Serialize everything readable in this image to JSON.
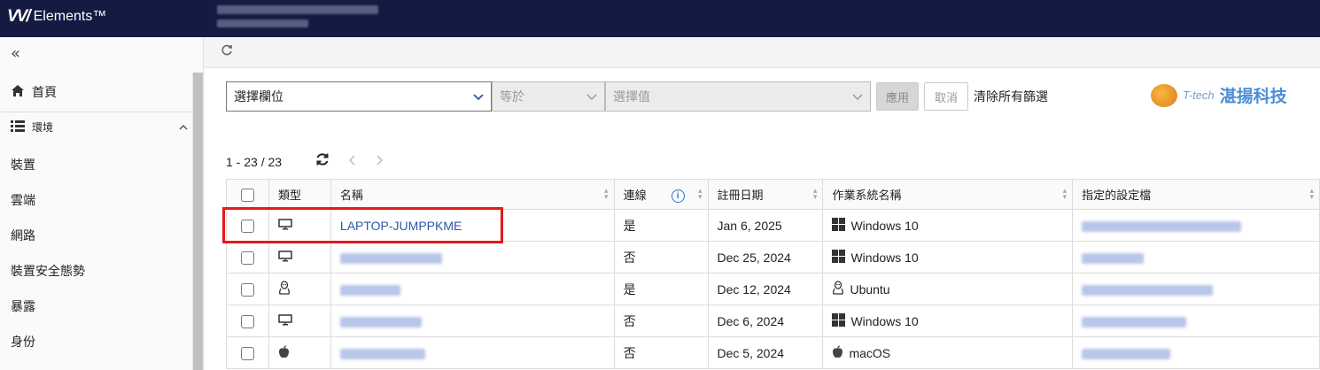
{
  "app": {
    "title": "Elements™"
  },
  "sidebar": {
    "collapse_glyph": "«",
    "items": [
      {
        "label": "首頁",
        "icon": "home-icon"
      },
      {
        "label": "環境",
        "icon": "list-icon"
      },
      {
        "label": "裝置"
      },
      {
        "label": "雲端"
      },
      {
        "label": "網路"
      },
      {
        "label": "裝置安全態勢"
      },
      {
        "label": "暴露"
      },
      {
        "label": "身份"
      }
    ]
  },
  "filter": {
    "field_placeholder": "選擇欄位",
    "operator": "等於",
    "value_placeholder": "選擇值",
    "apply_label": "應用",
    "cancel_label": "取消",
    "clear_label": "清除所有篩選"
  },
  "brand": {
    "tech": "T-tech",
    "name": "湛揚科技"
  },
  "pager": {
    "range": "1 - 23 / 23"
  },
  "table": {
    "columns": [
      "類型",
      "名稱",
      "連線",
      "註冊日期",
      "作業系統名稱",
      "指定的設定檔"
    ],
    "rows": [
      {
        "type": "monitor",
        "name": "LAPTOP-JUMPPKME",
        "connected": "是",
        "date": "Jan 6, 2025",
        "os": "Windows 10",
        "os_icon": "windows"
      },
      {
        "type": "monitor",
        "name": "",
        "connected": "否",
        "date": "Dec 25, 2024",
        "os": "Windows 10",
        "os_icon": "windows"
      },
      {
        "type": "linux",
        "name": "",
        "connected": "是",
        "date": "Dec 12, 2024",
        "os": "Ubuntu",
        "os_icon": "linux"
      },
      {
        "type": "monitor",
        "name": "",
        "connected": "否",
        "date": "Dec 6, 2024",
        "os": "Windows 10",
        "os_icon": "windows"
      },
      {
        "type": "apple",
        "name": "",
        "connected": "否",
        "date": "Dec 5, 2024",
        "os": "macOS",
        "os_icon": "apple"
      }
    ]
  },
  "colors": {
    "topbar": "#141a42",
    "link": "#2d57a7",
    "highlight": "#e31b1b"
  }
}
